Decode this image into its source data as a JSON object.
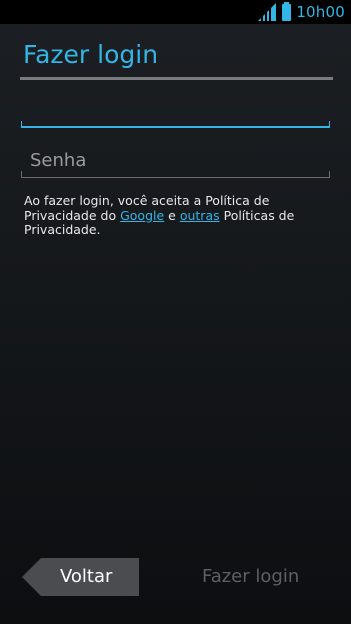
{
  "status_bar": {
    "time": "10h00",
    "icons": [
      "signal-icon",
      "battery-icon"
    ]
  },
  "header": {
    "title": "Fazer login"
  },
  "form": {
    "email": {
      "value": "",
      "placeholder": ""
    },
    "password": {
      "placeholder": "Senha"
    }
  },
  "legal": {
    "text_1": "Ao fazer login, você aceita a Política de Privacidade do ",
    "link_google": "Google",
    "text_2": " e ",
    "link_others": "outras",
    "text_3": " Políticas de Privacidade."
  },
  "footer": {
    "back_label": "Voltar",
    "login_label": "Fazer login"
  },
  "colors": {
    "accent": "#33b5e5",
    "disabled": "#5d6063"
  }
}
